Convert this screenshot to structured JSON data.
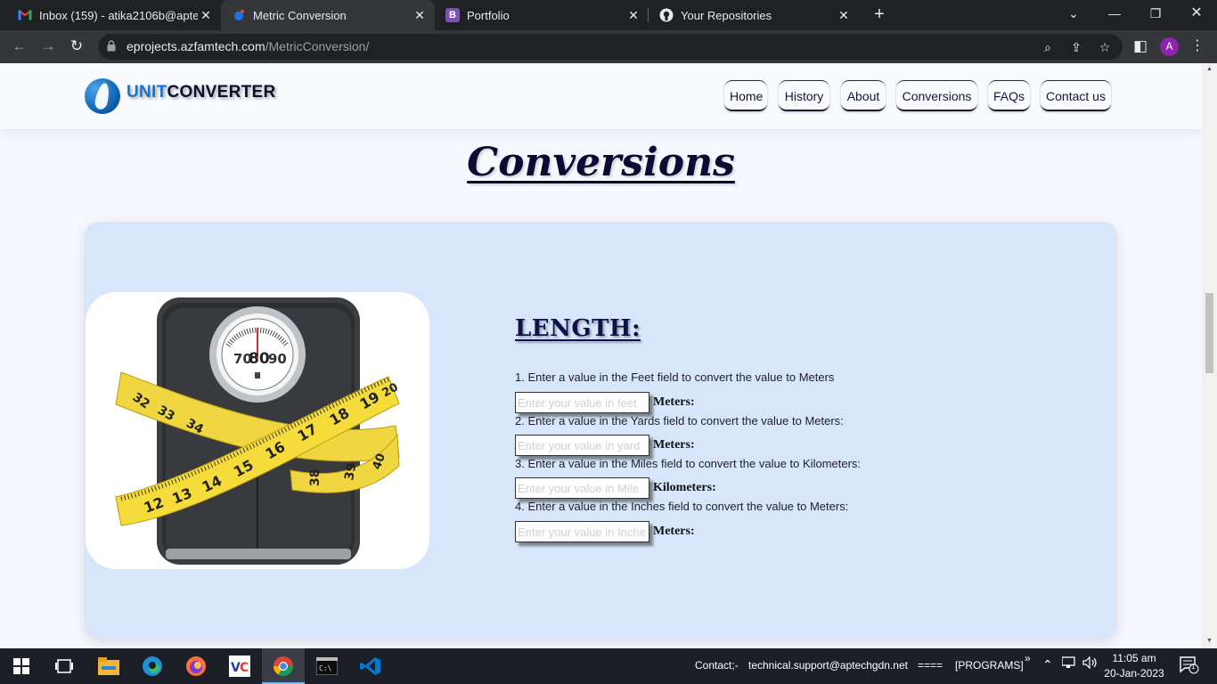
{
  "browser": {
    "tabs": [
      {
        "title": "Inbox (159) - atika2106b@aptech",
        "favicon": "gmail-icon",
        "active": false
      },
      {
        "title": "Metric Conversion",
        "favicon": "site-dot-icon",
        "active": true
      },
      {
        "title": "Portfolio",
        "favicon": "bootstrap-icon",
        "active": false
      },
      {
        "title": "Your Repositories",
        "favicon": "github-icon",
        "active": false
      }
    ],
    "tab_close": "✕",
    "new_tab": "+",
    "url_host": "eprojects.azfamtech.com",
    "url_path": "/MetricConversion/",
    "profile_initial": "A"
  },
  "site": {
    "brand_part1": "UNIT",
    "brand_part2": "CONVERTER",
    "nav": [
      "Home",
      "History",
      "About",
      "Conversions",
      "FAQs",
      "Contact us"
    ]
  },
  "page": {
    "title": "Conversions",
    "section_title": "LENGTH:",
    "rows": [
      {
        "instruction": "1. Enter a value in the Feet field to convert the value to Meters",
        "placeholder": "Enter your value in feet",
        "unit": "Meters:"
      },
      {
        "instruction": "2. Enter a value in the Yards field to convert the value to Meters:",
        "placeholder": "Enter your value in yard",
        "unit": "Meters:"
      },
      {
        "instruction": "3. Enter a value in the Miles field to convert the value to Kilometers:",
        "placeholder": "Enter your value in Mile",
        "unit": "Kilometers:"
      },
      {
        "instruction": "4. Enter a value in the Inches field to convert the value to Meters:",
        "placeholder": "Enter your value in Inche",
        "unit": "Meters:"
      }
    ],
    "scale_dial": [
      "70",
      "80",
      "90"
    ],
    "tape_numbers_front": [
      "12",
      "13",
      "14",
      "15",
      "16",
      "17",
      "18",
      "19",
      "20"
    ],
    "tape_numbers_back": [
      "32",
      "33",
      "34",
      "38",
      "39",
      "40"
    ]
  },
  "taskbar": {
    "contact_label": "Contact;-",
    "contact_email": "technical.support@aptechgdn.net",
    "separator": "====",
    "programs": "[PROGRAMS]",
    "time": "11:05 am",
    "date": "20-Jan-2023",
    "notification_count": "1"
  }
}
